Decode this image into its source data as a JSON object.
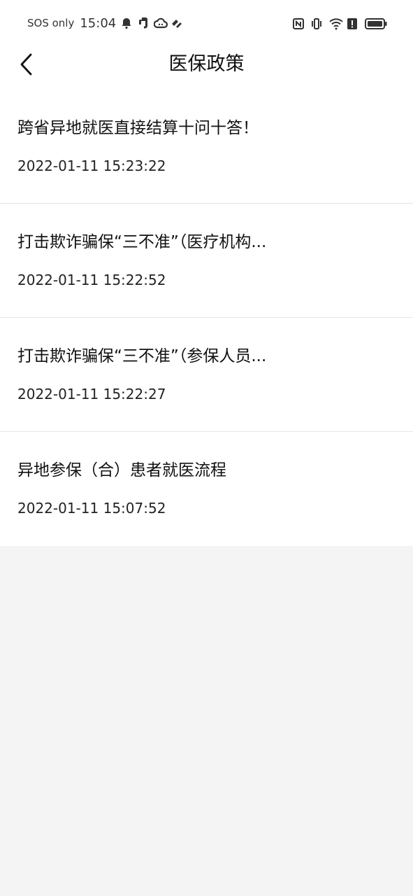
{
  "status_bar": {
    "carrier": "SOS only",
    "time": "15:04",
    "icons_left": [
      "bell-icon",
      "evernote-icon",
      "cloud-icon",
      "app-icon"
    ],
    "icons_right": [
      "nfc-icon",
      "vibrate-icon",
      "wifi-icon",
      "alert-icon",
      "battery-icon"
    ]
  },
  "nav": {
    "title": "医保政策",
    "back_icon": "chevron-left-icon"
  },
  "items": [
    {
      "title": "跨省异地就医直接结算十问十答！",
      "date": "2022-01-11 15:23:22"
    },
    {
      "title": "打击欺诈骗保“三不准”（医疗机构...",
      "date": "2022-01-11 15:22:52"
    },
    {
      "title": "打击欺诈骗保“三不准”（参保人员...",
      "date": "2022-01-11 15:22:27"
    },
    {
      "title": "异地参保（合）患者就医流程",
      "date": "2022-01-11 15:07:52"
    }
  ],
  "colors": {
    "background": "#f4f4f4",
    "surface": "#ffffff",
    "divider": "#e6e6e6",
    "text": "#111111"
  }
}
